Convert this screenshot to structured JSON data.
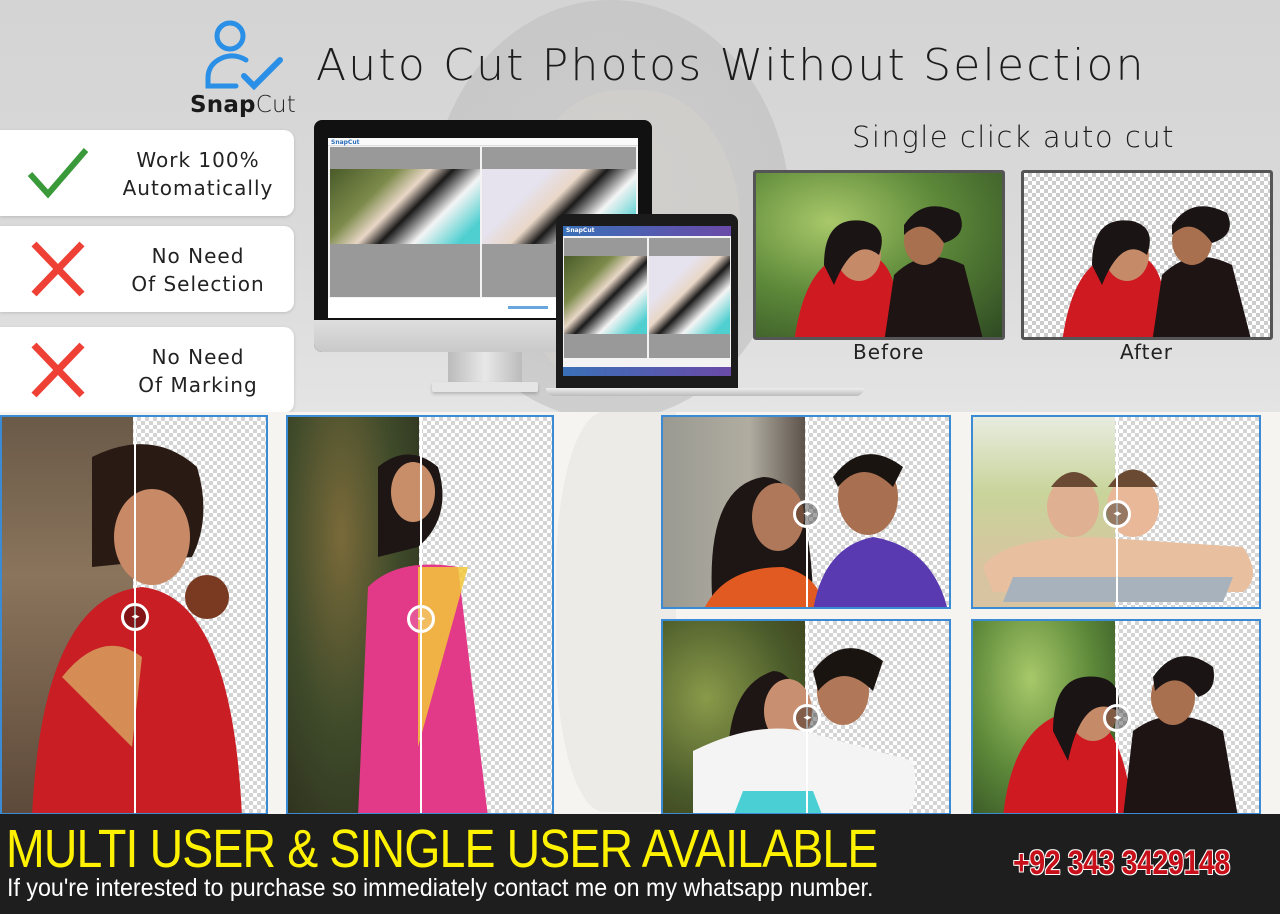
{
  "brand": {
    "logo_text_bold": "Snap",
    "logo_text_light": "Cut",
    "logo_icon": "user-check-icon",
    "accent_color": "#2a8fe6"
  },
  "header": {
    "headline": "Auto Cut Photos Without Selection",
    "subheadline": "Single click auto cut"
  },
  "features": [
    {
      "icon": "checkmark-icon",
      "icon_color": "#3a9a3a",
      "line1": "Work 100%",
      "line2": "Automatically"
    },
    {
      "icon": "cross-icon",
      "icon_color": "#ee4035",
      "line1": "No Need",
      "line2": "Of Selection"
    },
    {
      "icon": "cross-icon",
      "icon_color": "#ee4035",
      "line1": "No Need",
      "line2": "Of Marking"
    }
  ],
  "devices": {
    "monitor_app_title": "SnapCut",
    "laptop_app_title": "SnapCut"
  },
  "comparison": {
    "before_label": "Before",
    "after_label": "After"
  },
  "grid": {
    "panels": [
      {
        "name": "bride-portrait",
        "handle": "◂▸"
      },
      {
        "name": "saree-portrait",
        "handle": "◂▸"
      },
      {
        "name": "wedding-couple",
        "handle": "◂▸"
      },
      {
        "name": "girls-on-pillow",
        "handle": "◂▸"
      },
      {
        "name": "hugging-couple",
        "handle": "◂▸"
      },
      {
        "name": "sunglasses-couple",
        "handle": "◂▸"
      }
    ],
    "panel_border_color": "#3a8bd4"
  },
  "footer": {
    "tagline": "MULTI USER & SINGLE USER AVAILABLE",
    "tagline_color": "#fff200",
    "phone": "+92 343 3429148",
    "phone_color": "#c8101a",
    "note": "If you're interested to purchase so immediately contact me on my whatsapp number."
  }
}
